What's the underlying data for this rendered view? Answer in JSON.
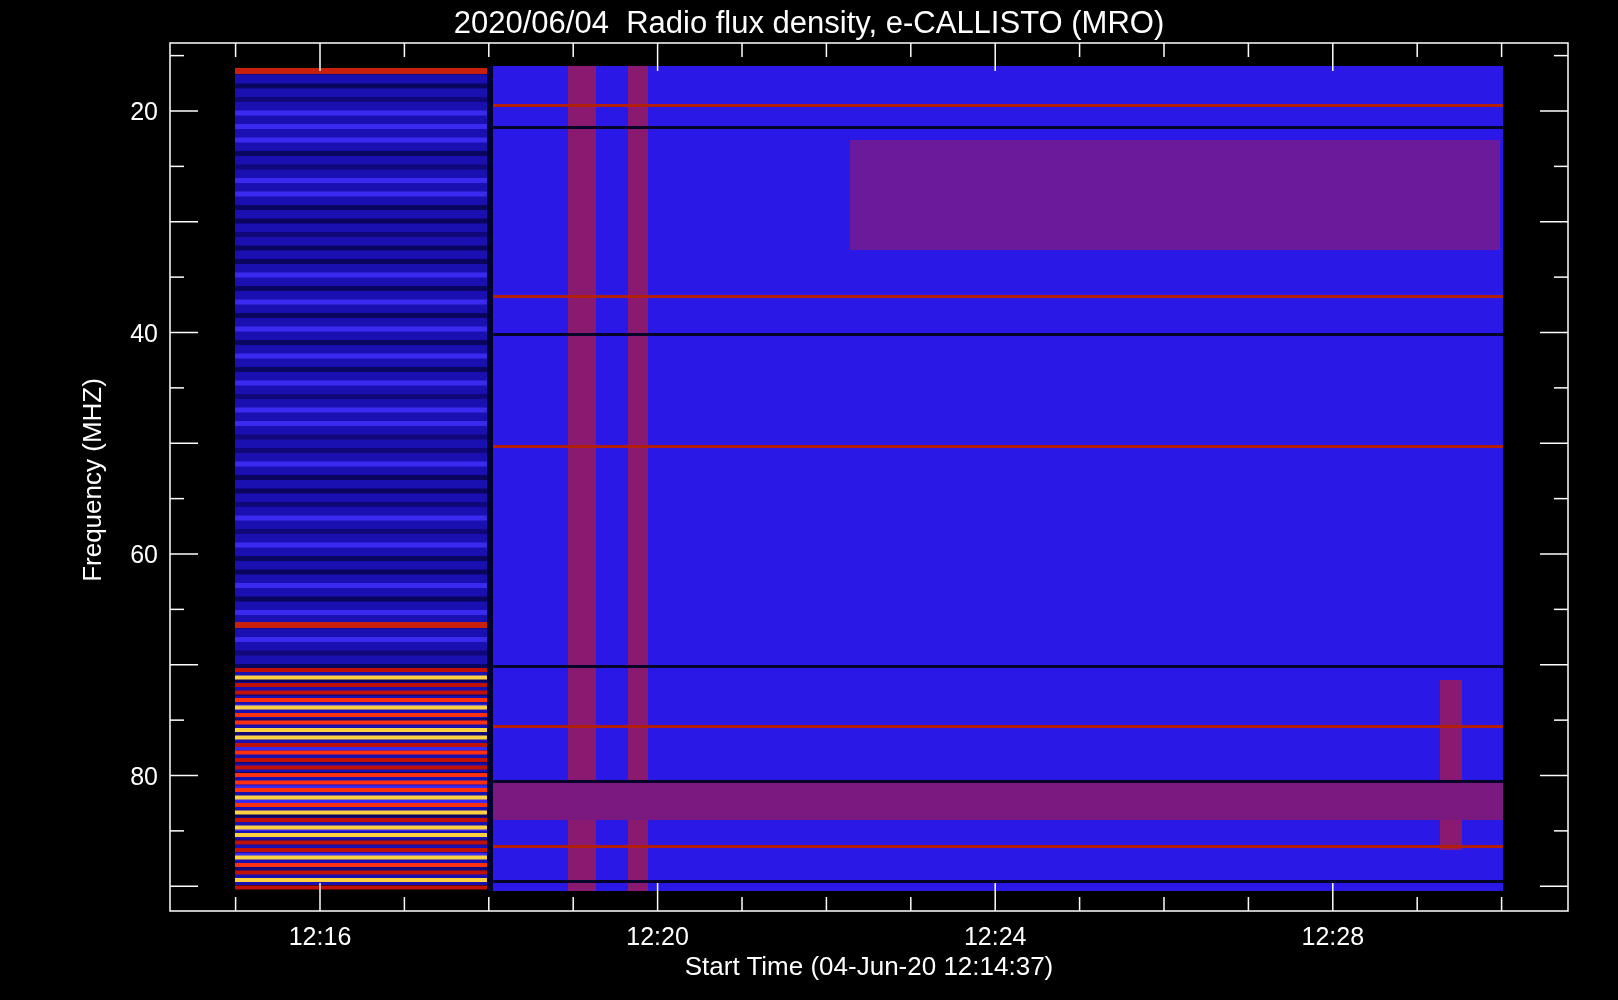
{
  "chart": {
    "title": "2020/06/04  Radio flux density, e-CALLISTO (MRO)",
    "ylabel": "Frequency (MHZ)",
    "xlabel": "Start Time (04-Jun-20 12:14:37)",
    "yticks": [
      "20",
      "40",
      "60",
      "80"
    ],
    "xticks": [
      "12:16",
      "12:20",
      "12:24",
      "12:28"
    ]
  }
}
